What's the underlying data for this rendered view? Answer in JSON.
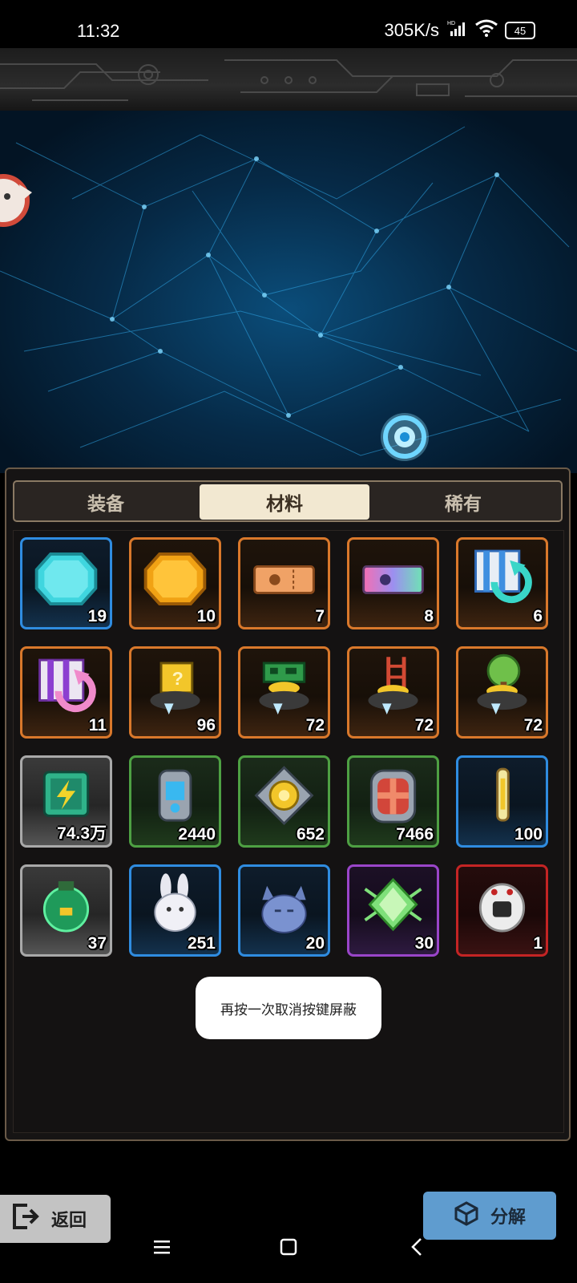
{
  "status_bar": {
    "time": "11:32",
    "net_speed": "305K/s",
    "battery": "45",
    "icons": [
      "signal-icon",
      "wifi-icon",
      "battery-icon"
    ]
  },
  "tabs": [
    {
      "label": "装备",
      "active": false
    },
    {
      "label": "材料",
      "active": true
    },
    {
      "label": "稀有",
      "active": false
    }
  ],
  "items": [
    {
      "icon": "cyan-gem-icon",
      "count": "19",
      "rarity": "blue"
    },
    {
      "icon": "gold-gem-icon",
      "count": "10",
      "rarity": "orange"
    },
    {
      "icon": "orange-ticket-icon",
      "count": "7",
      "rarity": "orange"
    },
    {
      "icon": "rainbow-ticket-icon",
      "count": "8",
      "rarity": "orange"
    },
    {
      "icon": "blue-recycle-box-icon",
      "count": "6",
      "rarity": "orange"
    },
    {
      "icon": "purple-recycle-box-icon",
      "count": "11",
      "rarity": "orange"
    },
    {
      "icon": "mystery-box-pot-icon",
      "count": "96",
      "rarity": "orange"
    },
    {
      "icon": "circuit-pot-icon",
      "count": "72",
      "rarity": "orange"
    },
    {
      "icon": "ladder-pot-icon",
      "count": "72",
      "rarity": "orange"
    },
    {
      "icon": "tree-pot-icon",
      "count": "72",
      "rarity": "orange"
    },
    {
      "icon": "battery-pack-icon",
      "count": "74.3万",
      "rarity": "gray"
    },
    {
      "icon": "blue-core-icon",
      "count": "2440",
      "rarity": "green"
    },
    {
      "icon": "gold-gear-core-icon",
      "count": "652",
      "rarity": "green"
    },
    {
      "icon": "red-core-icon",
      "count": "7466",
      "rarity": "green"
    },
    {
      "icon": "energy-crystal-icon",
      "count": "100",
      "rarity": "blue"
    },
    {
      "icon": "green-potion-bag-icon",
      "count": "37",
      "rarity": "gray"
    },
    {
      "icon": "white-rabbit-icon",
      "count": "251",
      "rarity": "blue"
    },
    {
      "icon": "blue-cat-icon",
      "count": "20",
      "rarity": "blue"
    },
    {
      "icon": "green-diamond-icon",
      "count": "30",
      "rarity": "purple"
    },
    {
      "icon": "white-robot-head-icon",
      "count": "1",
      "rarity": "red"
    }
  ],
  "toast": "再按一次取消按键屏蔽",
  "buttons": {
    "back": "返回",
    "decompose": "分解"
  }
}
